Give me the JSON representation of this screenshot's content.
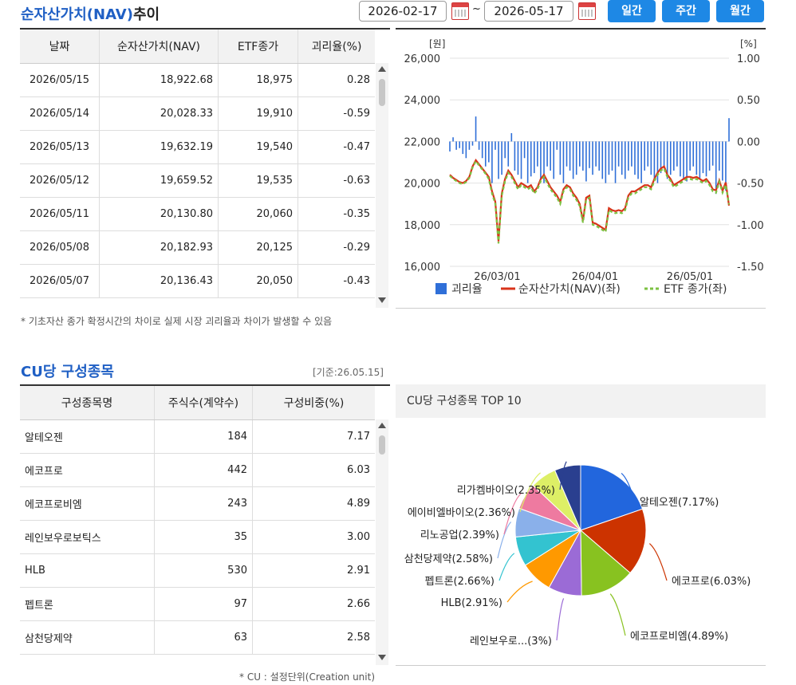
{
  "nav_section": {
    "title_highlight": "순자산가치(NAV)",
    "title_suffix": "추이",
    "date_from": "2026-02-17",
    "date_sep": "~",
    "date_to": "2026-05-17",
    "buttons": [
      "일간",
      "주간",
      "월간"
    ],
    "table": {
      "headers": [
        "날짜",
        "순자산가치(NAV)",
        "ETF종가",
        "괴리율(%)"
      ],
      "rows": [
        [
          "2026/05/15",
          "18,922.68",
          "18,975",
          "0.28"
        ],
        [
          "2026/05/14",
          "20,028.33",
          "19,910",
          "-0.59"
        ],
        [
          "2026/05/13",
          "19,632.19",
          "19,540",
          "-0.47"
        ],
        [
          "2026/05/12",
          "19,659.52",
          "19,535",
          "-0.63"
        ],
        [
          "2026/05/11",
          "20,130.80",
          "20,060",
          "-0.35"
        ],
        [
          "2026/05/08",
          "20,182.93",
          "20,125",
          "-0.29"
        ],
        [
          "2026/05/07",
          "20,136.43",
          "20,050",
          "-0.43"
        ]
      ]
    },
    "note": "* 기초자산 종가 확정시간의 차이로 실제 시장 괴리율과 차이가 발생할 수 있음"
  },
  "chart_data": [
    {
      "type": "line",
      "left_unit": "[원]",
      "right_unit": "[%]",
      "ylim_left": [
        16000,
        26000
      ],
      "ylim_right": [
        -1.5,
        1.0
      ],
      "left_ticks": [
        "26,000",
        "24,000",
        "22,000",
        "20,000",
        "18,000",
        "16,000"
      ],
      "right_ticks": [
        "1.00",
        "0.50",
        "0.00",
        "-0.50",
        "-1.00",
        "-1.50"
      ],
      "x_ticks": [
        "26/03/01",
        "26/04/01",
        "26/05/01"
      ],
      "legend": [
        "괴리율",
        "순자산가치(NAV)(좌)",
        "ETF 종가(좌)"
      ],
      "grid": true,
      "colors": {
        "premium": "#2f6fd8",
        "nav": "#d9331a",
        "etf": "#7cc242"
      },
      "nav": [
        20400,
        20250,
        20150,
        20050,
        20000,
        20100,
        20300,
        20800,
        21100,
        20900,
        20700,
        20500,
        20300,
        19600,
        19100,
        17200,
        19500,
        20200,
        20600,
        20400,
        20100,
        19800,
        20000,
        19900,
        19800,
        19900,
        19600,
        19800,
        20200,
        20400,
        20100,
        19800,
        19600,
        19400,
        19100,
        19700,
        19900,
        19800,
        19500,
        19300,
        19000,
        18200,
        19300,
        19400,
        18100,
        18050,
        17950,
        17850,
        17750,
        18800,
        18700,
        18650,
        18700,
        18650,
        18800,
        19400,
        19600,
        19600,
        19700,
        19800,
        19900,
        19900,
        19800,
        20200,
        20500,
        20700,
        20800,
        20400,
        20200,
        19900,
        20000,
        20100,
        20200,
        20300,
        20300,
        20250,
        20300,
        20200,
        20100,
        20200,
        20000,
        19700,
        19650,
        20130,
        19630,
        20030,
        18920
      ],
      "etf": [
        20350,
        20200,
        20100,
        20000,
        19950,
        20050,
        20250,
        20750,
        21050,
        20850,
        20650,
        20450,
        20200,
        19500,
        19000,
        17100,
        19400,
        20100,
        20500,
        20300,
        20000,
        19700,
        19900,
        19800,
        19700,
        19800,
        19500,
        19700,
        20100,
        20300,
        20000,
        19700,
        19500,
        19300,
        19000,
        19600,
        19800,
        19700,
        19400,
        19200,
        18900,
        18100,
        19200,
        19300,
        18000,
        17950,
        17850,
        17750,
        17650,
        18700,
        18600,
        18550,
        18600,
        18550,
        18700,
        19300,
        19500,
        19500,
        19600,
        19700,
        19800,
        19800,
        19700,
        20100,
        20400,
        20600,
        20700,
        20300,
        20100,
        19800,
        19900,
        20000,
        20100,
        20200,
        20200,
        20150,
        20200,
        20100,
        20000,
        20100,
        19900,
        19600,
        19535,
        20060,
        19540,
        19910,
        18975
      ],
      "premium": [
        -0.12,
        0.05,
        -0.1,
        -0.08,
        -0.15,
        -0.2,
        -0.1,
        -0.05,
        0.3,
        -0.1,
        -0.2,
        -0.3,
        -0.25,
        -0.5,
        -0.1,
        -0.45,
        -0.4,
        -0.2,
        -0.3,
        0.1,
        -0.35,
        -0.4,
        -0.45,
        -0.2,
        -0.5,
        -0.42,
        -0.38,
        -0.3,
        -0.45,
        -0.5,
        -0.3,
        -0.35,
        -0.45,
        -0.1,
        -0.4,
        -0.5,
        -0.3,
        -0.35,
        -0.45,
        -0.4,
        -0.3,
        -0.35,
        -0.48,
        -0.32,
        -0.4,
        -0.3,
        -0.35,
        -0.45,
        -0.5,
        -0.4,
        -0.35,
        -0.5,
        -0.3,
        -0.4,
        -0.45,
        -0.35,
        -0.3,
        -0.4,
        -0.45,
        -0.5,
        -0.35,
        -0.3,
        -0.4,
        -0.45,
        -0.5,
        -0.38,
        -0.32,
        -0.45,
        -0.4,
        -0.35,
        -0.3,
        -0.42,
        -0.45,
        -0.48,
        -0.35,
        -0.3,
        -0.4,
        -0.45,
        -0.38,
        -0.42,
        -0.35,
        -0.29,
        -0.63,
        -0.35,
        -0.47,
        -0.59,
        0.28
      ]
    },
    {
      "type": "pie",
      "title": "CU당 구성종목 TOP 10",
      "labels": [
        "알테오젠(7.17%)",
        "에코프로(6.03%)",
        "에코프로비엠(4.89%)",
        "레인보우로...(3%)",
        "HLB(2.91%)",
        "펩트론(2.66%)",
        "삼천당제약(2.58%)",
        "리노공업(2.39%)",
        "에이비엘바이오(2.36%)",
        "리가켐바이오(2.35%)"
      ],
      "values": [
        7.17,
        6.03,
        4.89,
        3.0,
        2.91,
        2.66,
        2.58,
        2.39,
        2.36,
        2.35
      ],
      "colors": [
        "#2266dd",
        "#cc3300",
        "#88c220",
        "#9b6bd6",
        "#ff9900",
        "#33c3d0",
        "#8ab0ea",
        "#ee7aa0",
        "#ddef66",
        "#2a3f8f"
      ]
    }
  ],
  "cu_section": {
    "title": "CU당 구성종목",
    "basis": "[기준:26.05.15]",
    "table": {
      "headers": [
        "구성종목명",
        "주식수(계약수)",
        "구성비중(%)"
      ],
      "rows": [
        [
          "알테오젠",
          "184",
          "7.17"
        ],
        [
          "에코프로",
          "442",
          "6.03"
        ],
        [
          "에코프로비엠",
          "243",
          "4.89"
        ],
        [
          "레인보우로보틱스",
          "35",
          "3.00"
        ],
        [
          "HLB",
          "530",
          "2.91"
        ],
        [
          "펩트론",
          "97",
          "2.66"
        ],
        [
          "삼천당제약",
          "63",
          "2.58"
        ]
      ]
    },
    "note": "* CU : 설정단위(Creation unit)"
  }
}
